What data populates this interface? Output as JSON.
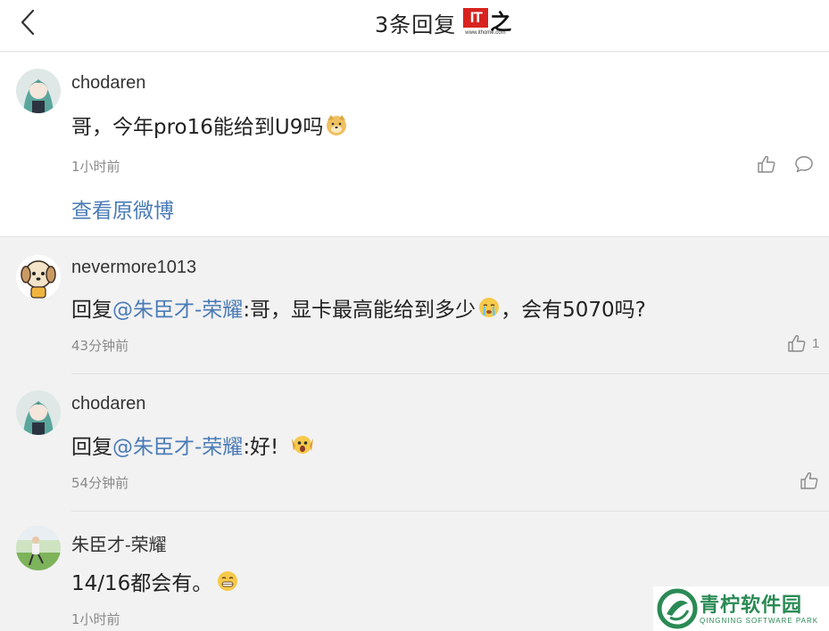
{
  "header": {
    "title": "3条回复",
    "logo_badge": "IT",
    "logo_char": "之家",
    "logo_url": "www.ithome.com"
  },
  "main_comment": {
    "username": "chodaren",
    "content": "哥，今年pro16能给到U9吗",
    "emoji": "doge-emoji",
    "time": "1小时前",
    "view_original": "查看原微博"
  },
  "replies": [
    {
      "username": "nevermore1013",
      "reply_prefix": "回复",
      "mention": "@朱臣才-荣耀",
      "text_before_emoji": ":哥，显卡最高能给到多少",
      "emoji": "crying-emoji",
      "text_after_emoji": "，会有5070吗?",
      "time": "43分钟前",
      "likes": "1"
    },
    {
      "username": "chodaren",
      "reply_prefix": "回复",
      "mention": "@朱臣才-荣耀",
      "text_before_emoji": ":好!",
      "emoji": "scream-emoji",
      "time": "54分钟前"
    },
    {
      "username": "朱臣才-荣耀",
      "text_before_emoji": "14/16都会有。",
      "emoji": "grin-emoji",
      "time": "1小时前"
    }
  ],
  "watermark": {
    "title": "青柠软件园",
    "subtitle": "QINGNING SOFTWARE PARK"
  },
  "colors": {
    "link": "#4a7bb7",
    "background": "#f2f2f2",
    "brand_red": "#d8231f",
    "watermark_green": "#2a8a55"
  }
}
